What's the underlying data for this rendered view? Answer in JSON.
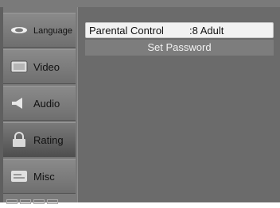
{
  "sidebar": {
    "items": [
      {
        "label": "Language",
        "icon": "language-icon"
      },
      {
        "label": "Video",
        "icon": "video-icon"
      },
      {
        "label": "Audio",
        "icon": "audio-icon"
      },
      {
        "label": "Rating",
        "icon": "lock-icon",
        "selected": true
      },
      {
        "label": "Misc",
        "icon": "misc-icon"
      }
    ]
  },
  "content": {
    "parental_control": {
      "label": "Parental Control",
      "value": ":8 Adult"
    },
    "set_password": {
      "label": "Set Password"
    }
  },
  "colors": {
    "background": "#5f5f5f",
    "highlight": "#f2f2f2"
  }
}
